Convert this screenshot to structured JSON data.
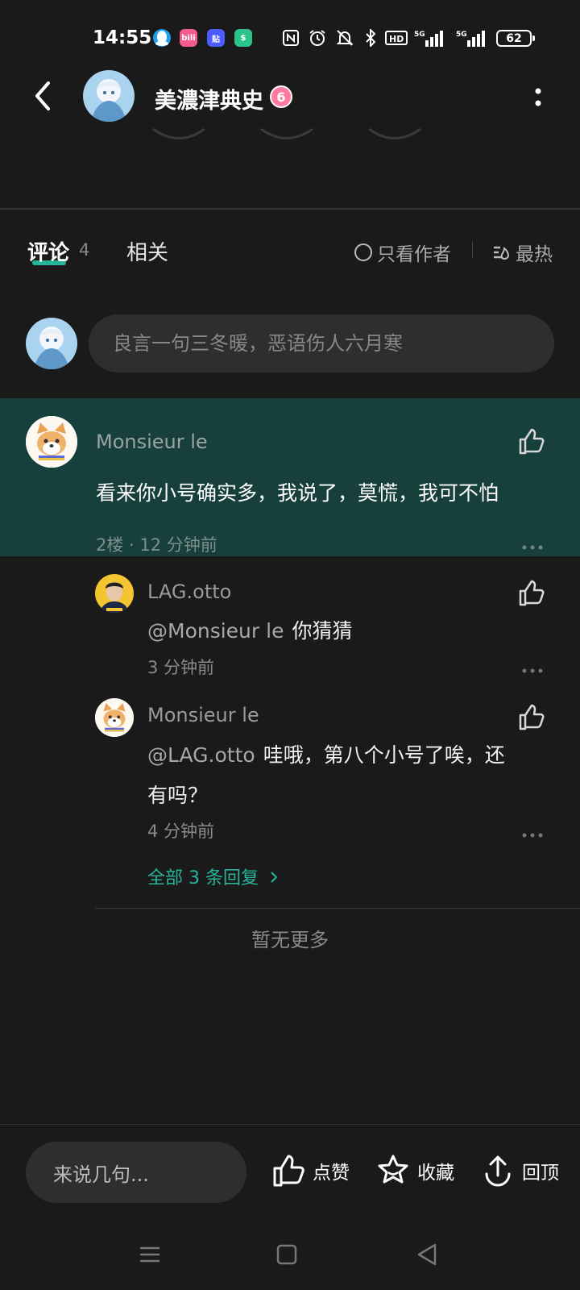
{
  "status_bar": {
    "time": "14:55",
    "battery": "62",
    "app_icons": [
      "qq-icon",
      "bilibili-icon",
      "tieba-icon",
      "shield-app-icon"
    ],
    "system_icons": [
      "nfc-icon",
      "alarm-icon",
      "mute-icon",
      "bluetooth-icon",
      "hd-icon",
      "signal-5g-icon",
      "signal-5g-icon"
    ]
  },
  "header": {
    "title": "美濃津典史",
    "level_badge": "6"
  },
  "tabs": {
    "comments_label": "评论",
    "comments_count": "4",
    "related_label": "相关",
    "author_only_label": "只看作者",
    "sort_label": "最热"
  },
  "composer": {
    "placeholder": "良言一句三冬暖，恶语伤人六月寒"
  },
  "comment": {
    "author": "Monsieur le",
    "text": "看来你小号确实多，我说了，莫慌，我可不怕",
    "meta": "2楼 · 12 分钟前"
  },
  "replies": [
    {
      "author": "LAG.otto",
      "mention": "@Monsieur le",
      "text": "你猜猜",
      "meta": "3 分钟前"
    },
    {
      "author": "Monsieur le",
      "mention": "@LAG.otto",
      "text_line1": "哇哦，第八个小号了唉，还",
      "text_line2": "有吗？",
      "meta": "4 分钟前"
    }
  ],
  "all_replies_label": "全部 3 条回复",
  "no_more_label": "暂无更多",
  "bottom_bar": {
    "input_placeholder": "来说几句...",
    "like_label": "点赞",
    "favorite_label": "收藏",
    "top_label": "回顶"
  },
  "colors": {
    "accent": "#26b59a",
    "highlight_bg": "#173f3c",
    "background": "#1a1a1a"
  }
}
